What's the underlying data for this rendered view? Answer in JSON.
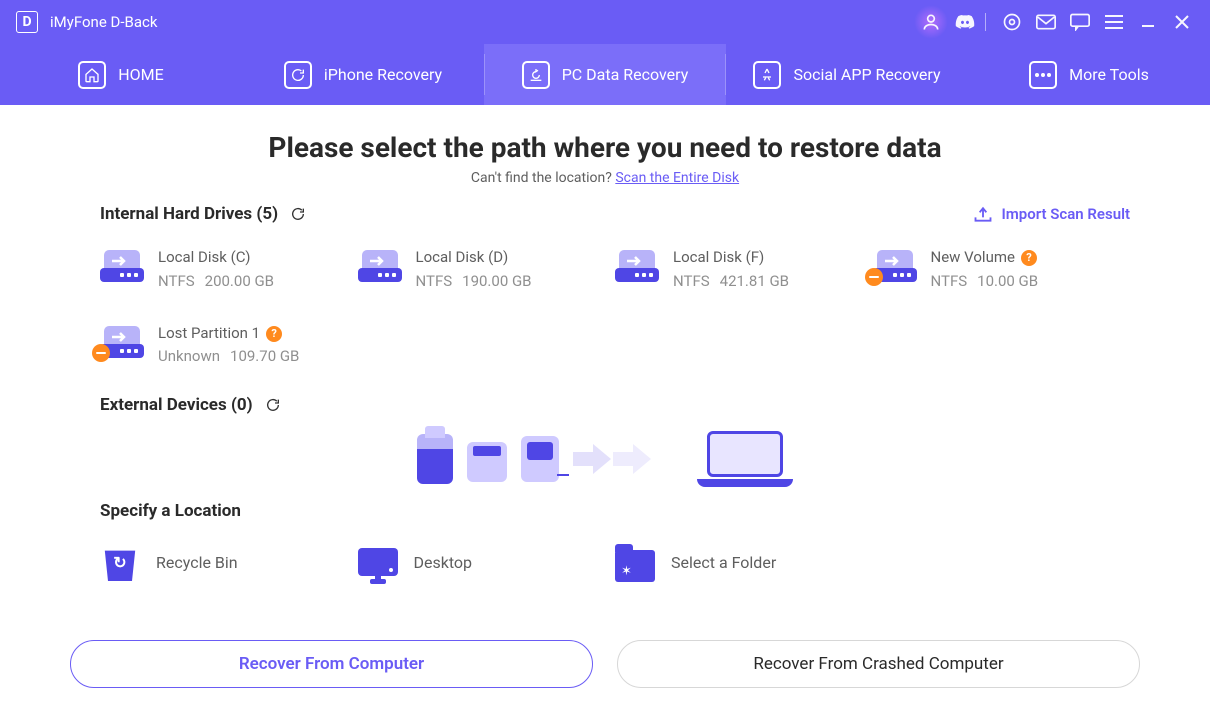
{
  "app": {
    "title": "iMyFone D-Back",
    "logo_letter": "D"
  },
  "tabs": [
    {
      "label": "HOME"
    },
    {
      "label": "iPhone Recovery"
    },
    {
      "label": "PC Data Recovery"
    },
    {
      "label": "Social APP Recovery"
    },
    {
      "label": "More Tools"
    }
  ],
  "active_tab_index": 2,
  "headline": "Please select the path where you need to restore data",
  "subline_prefix": "Can't find the location? ",
  "subline_link": "Scan the Entire Disk",
  "import_link": "Import Scan Result",
  "internal": {
    "title": "Internal Hard Drives (5)",
    "drives": [
      {
        "name": "Local Disk (C)",
        "fs": "NTFS",
        "size": "200.00 GB",
        "warn": false,
        "help": false
      },
      {
        "name": "Local Disk (D)",
        "fs": "NTFS",
        "size": "190.00 GB",
        "warn": false,
        "help": false
      },
      {
        "name": "Local Disk (F)",
        "fs": "NTFS",
        "size": "421.81 GB",
        "warn": false,
        "help": false
      },
      {
        "name": "New Volume",
        "fs": "NTFS",
        "size": "10.00 GB",
        "warn": true,
        "help": true
      },
      {
        "name": "Lost Partition 1",
        "fs": "Unknown",
        "size": "109.70 GB",
        "warn": true,
        "help": true
      }
    ]
  },
  "external": {
    "title": "External Devices (0)"
  },
  "specify": {
    "title": "Specify a Location",
    "items": [
      {
        "label": "Recycle Bin"
      },
      {
        "label": "Desktop"
      },
      {
        "label": "Select a Folder"
      }
    ]
  },
  "buttons": {
    "recover_computer": "Recover From Computer",
    "recover_crashed": "Recover From Crashed Computer"
  }
}
